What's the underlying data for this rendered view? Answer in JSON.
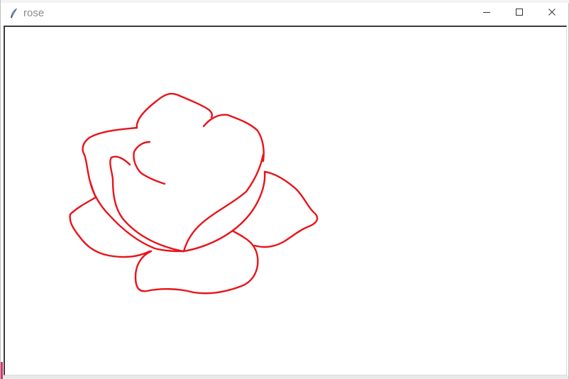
{
  "window": {
    "title": "rose",
    "app_icon": "feather-icon",
    "controls": {
      "minimize": "minimize-icon",
      "maximize": "maximize-icon",
      "close": "close-icon"
    }
  },
  "canvas": {
    "background": "#ffffff",
    "stroke_color": "#e8141a",
    "drawing": "rose-outline"
  },
  "colors": {
    "title_text": "#8a8a8a",
    "icon_blue": "#2b5797",
    "control_glyph": "#333333"
  }
}
